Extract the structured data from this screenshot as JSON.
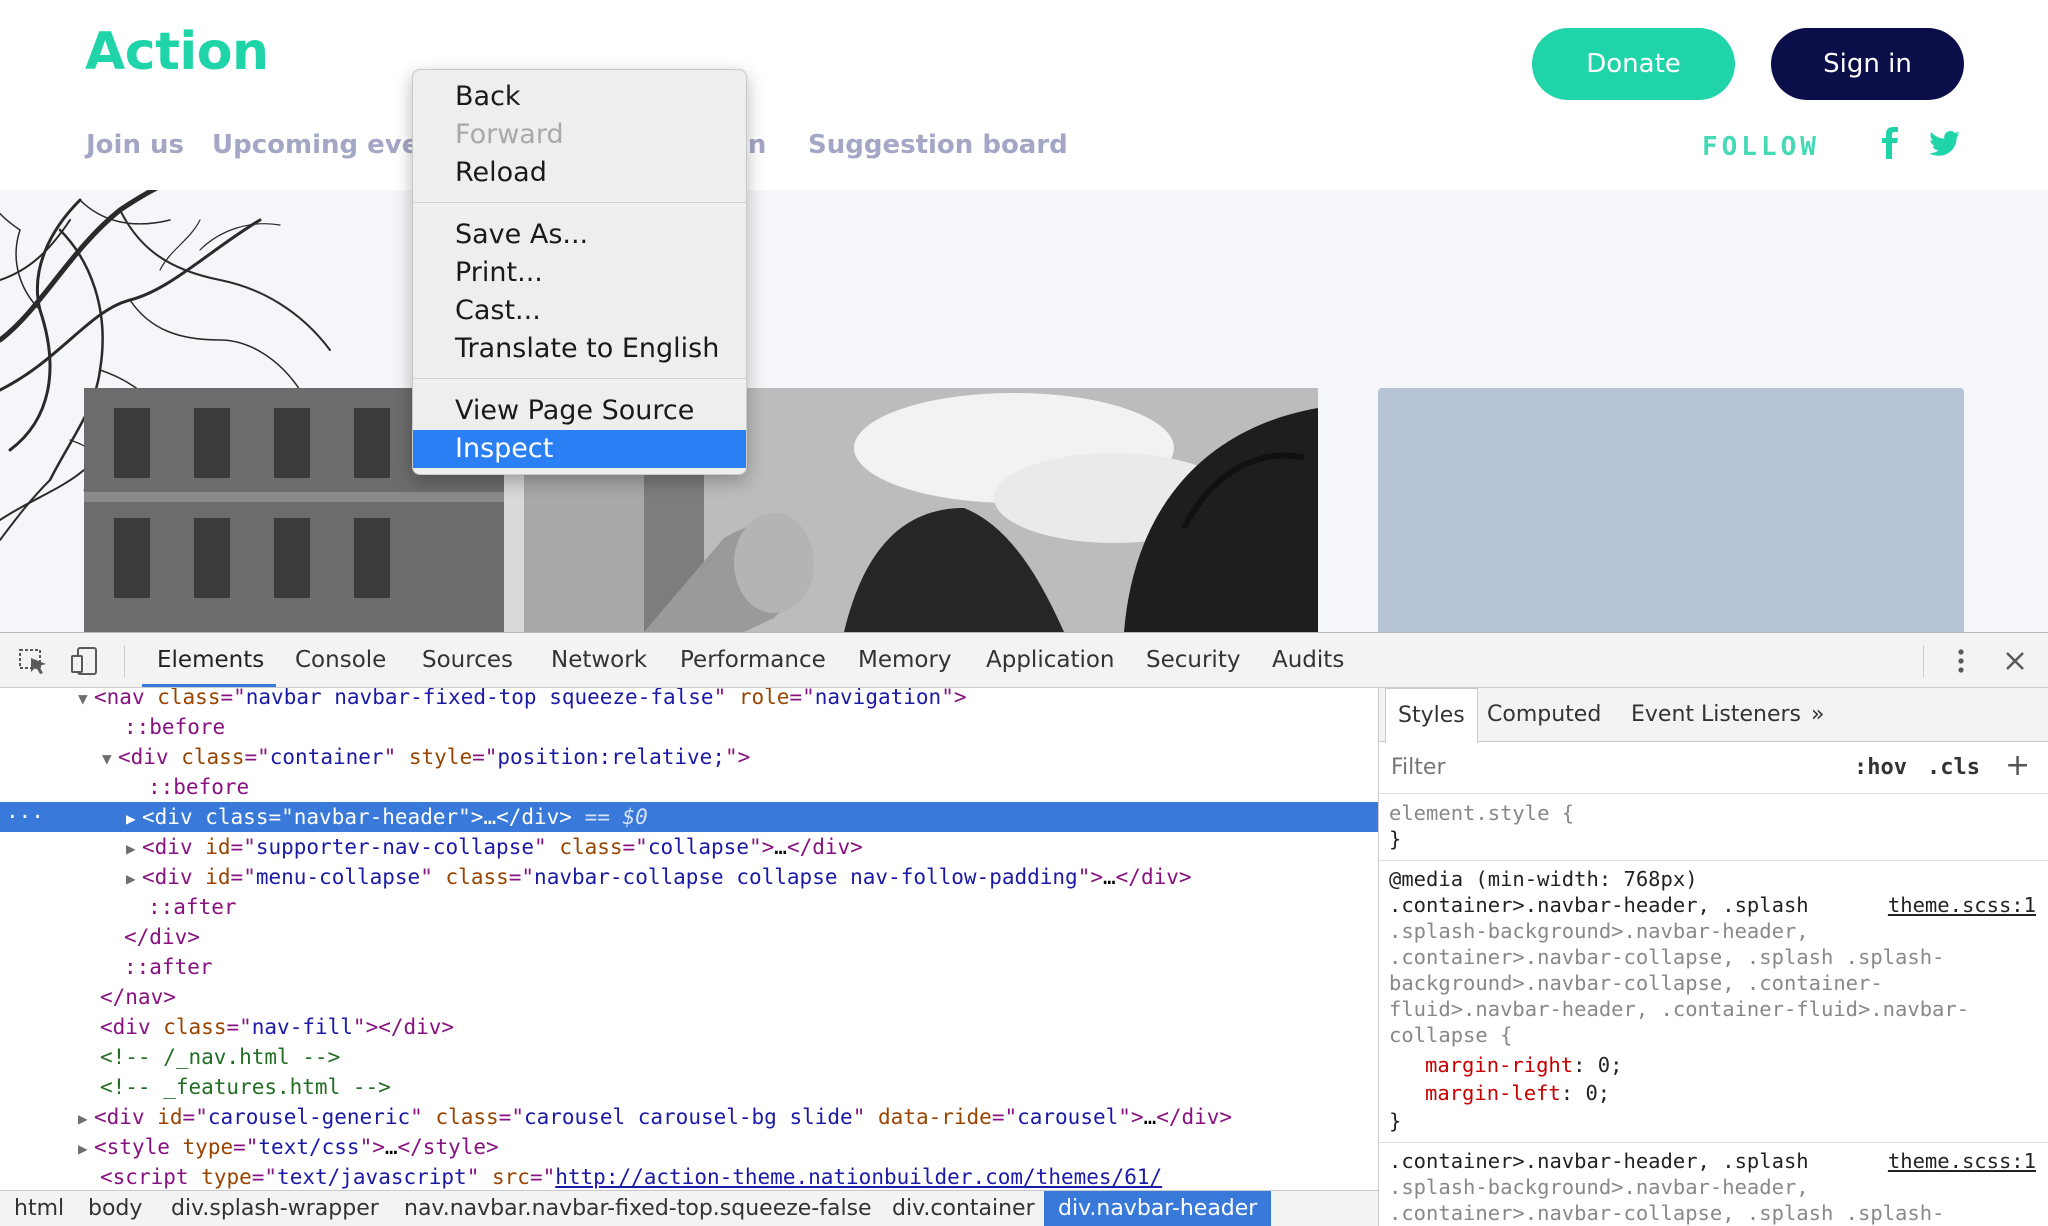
{
  "site": {
    "logo": "Action",
    "donate_label": "Donate",
    "signin_label": "Sign in",
    "nav": [
      {
        "label": "Join us"
      },
      {
        "label": "Upcoming events"
      },
      {
        "label": "...on"
      },
      {
        "label": "Suggestion board"
      }
    ],
    "follow_label": "FOLLOW",
    "social_icons": [
      "facebook-icon",
      "twitter-icon"
    ],
    "colors": {
      "brand_green": "#1ed4a8",
      "navy": "#0a0f4a",
      "nav_text": "#a4a6c6"
    }
  },
  "context_menu": {
    "groups": [
      [
        {
          "label": "Back",
          "enabled": true
        },
        {
          "label": "Forward",
          "enabled": false
        },
        {
          "label": "Reload",
          "enabled": true
        }
      ],
      [
        {
          "label": "Save As..."
        },
        {
          "label": "Print..."
        },
        {
          "label": "Cast..."
        },
        {
          "label": "Translate to English"
        }
      ],
      [
        {
          "label": "View Page Source"
        },
        {
          "label": "Inspect",
          "highlighted": true
        }
      ]
    ]
  },
  "devtools": {
    "tabs": [
      "Elements",
      "Console",
      "Sources",
      "Network",
      "Performance",
      "Memory",
      "Application",
      "Security",
      "Audits"
    ],
    "selected_tab": "Elements",
    "dom": {
      "nav": {
        "tag": "nav",
        "class": "navbar navbar-fixed-top squeeze-false",
        "role": "navigation"
      },
      "before": "::before",
      "after": "::after",
      "container": {
        "tag": "div",
        "class": "container",
        "style": "position:relative;"
      },
      "navbar_header": {
        "tag": "div",
        "class": "navbar-header",
        "marker": "== $0"
      },
      "supporter": {
        "tag": "div",
        "id": "supporter-nav-collapse",
        "class": "collapse"
      },
      "menu": {
        "tag": "div",
        "id": "menu-collapse",
        "class": "navbar-collapse collapse nav-follow-padding"
      },
      "close_div": "</div>",
      "close_nav": "</nav>",
      "nav_fill": {
        "tag": "div",
        "class": "nav-fill"
      },
      "comment1": "<!-- /_nav.html -->",
      "comment2": "<!-- _features.html -->",
      "carousel": {
        "tag": "div",
        "id": "carousel-generic",
        "class": "carousel carousel-bg slide",
        "data_ride": "carousel"
      },
      "style_tag": {
        "tag": "style",
        "type": "text/css"
      },
      "script_tag": {
        "tag": "script",
        "type": "text/javascript",
        "src": "http://action-theme.nationbuilder.com/themes/61/"
      },
      "ellipsis": "…"
    },
    "breadcrumbs": [
      "html",
      "body",
      "div.splash-wrapper",
      "nav.navbar.navbar-fixed-top.squeeze-false",
      "div.container",
      "div.navbar-header"
    ],
    "selected_breadcrumb": "div.navbar-header",
    "styles": {
      "tabs": [
        "Styles",
        "Computed",
        "Event Listeners"
      ],
      "more": "»",
      "filter_placeholder": "Filter",
      "hov": ":hov",
      "cls": ".cls",
      "add": "+",
      "element_style": "element.style {",
      "close_brace": "}",
      "media": "@media (min-width: 768px)",
      "rule1_lines": [
        ".container>.navbar-header, .splash",
        ".splash-background>.navbar-header,",
        ".container>.navbar-collapse, .splash .splash-",
        "background>.navbar-collapse, .container-",
        "fluid>.navbar-header, .container-fluid>.navbar-",
        "collapse {"
      ],
      "prop1": {
        "name": "margin-right",
        "value": "0;"
      },
      "prop2": {
        "name": "margin-left",
        "value": "0;"
      },
      "source": "theme.scss:1",
      "rule2_lines": [
        ".container>.navbar-header, .splash",
        ".splash-background>.navbar-header,",
        ".container>.navbar-collapse, .splash .splash-"
      ]
    }
  }
}
